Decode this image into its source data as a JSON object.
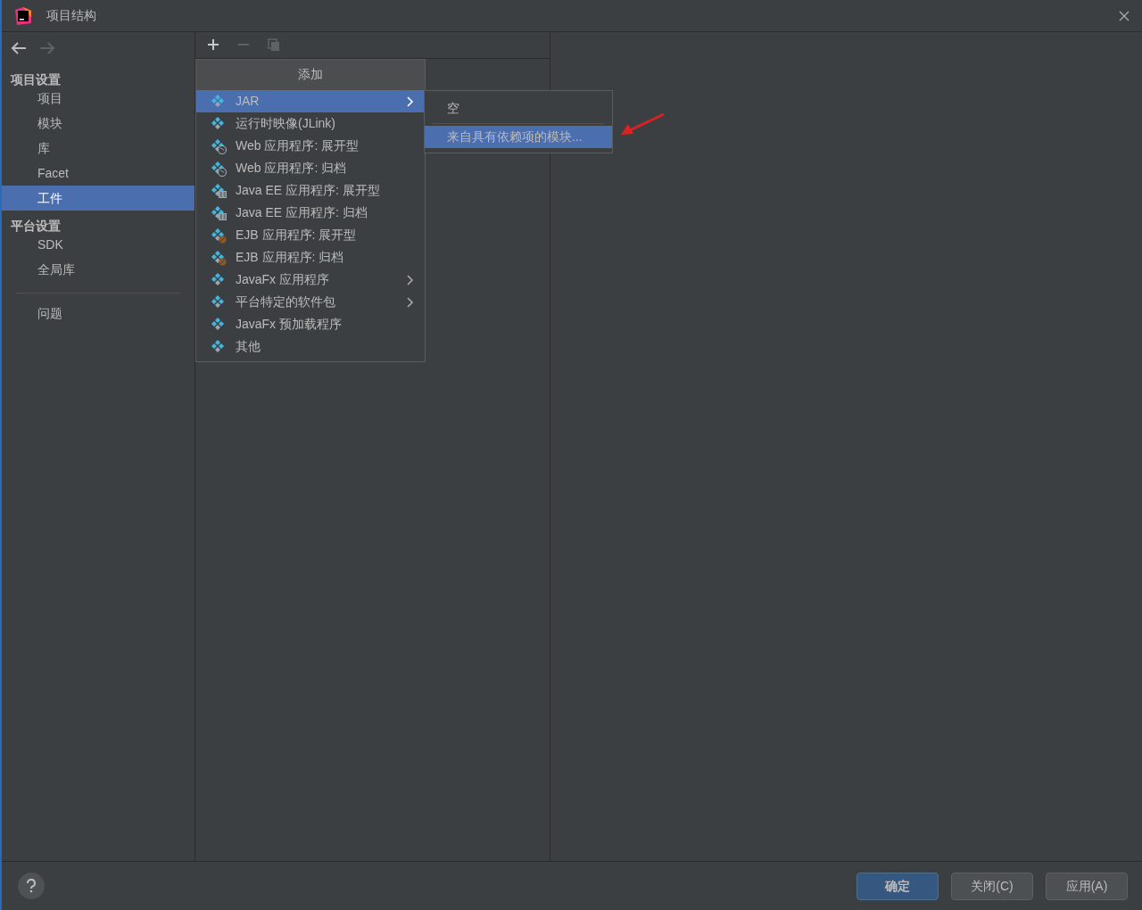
{
  "window": {
    "title": "项目结构"
  },
  "nav": {
    "back_disabled": false,
    "forward_disabled": true
  },
  "sidebar": {
    "sections": [
      {
        "title": "项目设置",
        "items": [
          {
            "label": "项目",
            "selected": false
          },
          {
            "label": "模块",
            "selected": false
          },
          {
            "label": "库",
            "selected": false
          },
          {
            "label": "Facet",
            "selected": false
          },
          {
            "label": "工件",
            "selected": true
          }
        ]
      },
      {
        "title": "平台设置",
        "items": [
          {
            "label": "SDK",
            "selected": false
          },
          {
            "label": "全局库",
            "selected": false
          }
        ]
      }
    ],
    "footer_items": [
      {
        "label": "问题",
        "selected": false
      }
    ]
  },
  "toolbar": [
    {
      "kind": "add",
      "disabled": false
    },
    {
      "kind": "remove",
      "disabled": true
    },
    {
      "kind": "copy",
      "disabled": true
    }
  ],
  "add_menu": {
    "title": "添加",
    "items": [
      {
        "label": "JAR",
        "kind": "plain",
        "submenu": true,
        "selected": true
      },
      {
        "label": "运行时映像(JLink)",
        "kind": "plain",
        "submenu": false,
        "selected": false
      },
      {
        "label": "Web 应用程序: 展开型",
        "kind": "web",
        "submenu": false,
        "selected": false
      },
      {
        "label": "Web 应用程序: 归档",
        "kind": "web",
        "submenu": false,
        "selected": false
      },
      {
        "label": "Java EE 应用程序: 展开型",
        "kind": "javaee",
        "submenu": false,
        "selected": false
      },
      {
        "label": "Java EE 应用程序: 归档",
        "kind": "javaee",
        "submenu": false,
        "selected": false
      },
      {
        "label": "EJB 应用程序: 展开型",
        "kind": "ejb",
        "submenu": false,
        "selected": false
      },
      {
        "label": "EJB 应用程序: 归档",
        "kind": "ejb",
        "submenu": false,
        "selected": false
      },
      {
        "label": "JavaFx 应用程序",
        "kind": "plain",
        "submenu": true,
        "selected": false
      },
      {
        "label": "平台特定的软件包",
        "kind": "plain",
        "submenu": true,
        "selected": false
      },
      {
        "label": "JavaFx 预加载程序",
        "kind": "plain",
        "submenu": false,
        "selected": false
      },
      {
        "label": "其他",
        "kind": "plain",
        "submenu": false,
        "selected": false
      }
    ]
  },
  "jar_submenu": {
    "items": [
      {
        "label": "空",
        "selected": false
      },
      {
        "label": "来自具有依赖项的模块...",
        "selected": true
      }
    ]
  },
  "buttons": [
    {
      "label": "确定",
      "default": true
    },
    {
      "label": "关闭(C)",
      "default": false
    },
    {
      "label": "应用(A)",
      "default": false
    }
  ]
}
